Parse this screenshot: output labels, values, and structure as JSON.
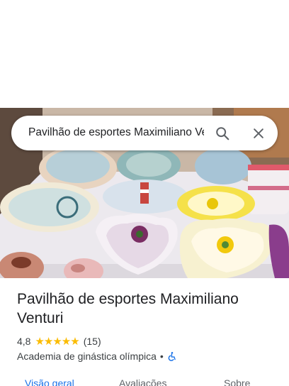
{
  "search": {
    "query": "Pavilhão de esportes Maximiliano Venturi",
    "search_icon": "search-icon",
    "close_icon": "close-icon"
  },
  "place": {
    "title": "Pavilhão de esportes Maximiliano Venturi",
    "rating": "4,8",
    "stars": "★★★★★",
    "star_count": 5,
    "review_count": "(15)",
    "category": "Academia de ginástica olímpica",
    "separator": "•",
    "accessibility_icon": "wheelchair-icon",
    "colors": {
      "star": "#fbbc04",
      "accent": "#1a73e8",
      "text": "#202124",
      "secondary": "#3c4043"
    }
  },
  "tabs": [
    {
      "label": "Visão geral",
      "active": true
    },
    {
      "label": "Avaliações",
      "active": false
    },
    {
      "label": "Sobre",
      "active": false
    }
  ]
}
